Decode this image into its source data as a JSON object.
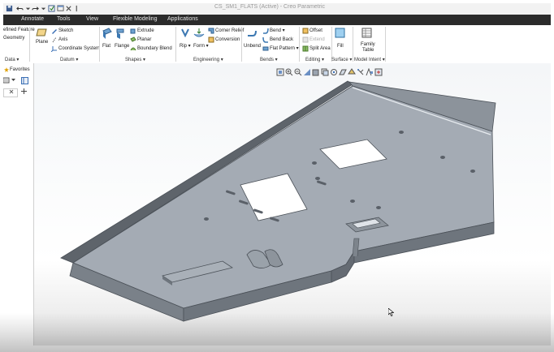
{
  "window": {
    "title": "CS_SM1_FLATS (Active) - Creo Parametric"
  },
  "menu_tabs": [
    "Annotate",
    "Tools",
    "View",
    "Flexible Modeling",
    "Applications"
  ],
  "ribbon": {
    "data_group": {
      "items": [
        "efined Feature",
        "Geometry"
      ],
      "label": "Data ▾"
    },
    "datum_group": {
      "plane": "Plane",
      "items": [
        "Sketch",
        "Axis",
        "Coordinate System"
      ],
      "label": "Datum ▾"
    },
    "shapes_group": {
      "flat": "Flat",
      "flange": "Flange",
      "items": [
        "Extrude",
        "Planar",
        "Boundary Blend"
      ],
      "label": "Shapes ▾"
    },
    "engineering_group": {
      "rip": "Rip ▾",
      "form": "Form ▾",
      "items": [
        "Corner Relief",
        "Conversion"
      ],
      "label": "Engineering ▾"
    },
    "bends_group": {
      "unbend": "Unbend",
      "items": [
        "Bend ▾",
        "Bend Back",
        "Flat Pattern ▾"
      ],
      "label": "Bends ▾"
    },
    "editing_group": {
      "items": [
        "Offset",
        "Extend",
        "Split Area"
      ],
      "label": "Editing ▾"
    },
    "surface_group": {
      "fill": "Fill",
      "label": "Surface ▾"
    },
    "model_intent_group": {
      "family_table_1": "Family",
      "family_table_2": "Table",
      "label": "Model Intent ▾"
    }
  },
  "left_panel": {
    "favorites": "Favorites"
  },
  "colors": {
    "tabbar": "#2b2b2b",
    "part_top": "#a4abb4",
    "part_side": "#6e757d",
    "part_edge": "#4b5158"
  }
}
